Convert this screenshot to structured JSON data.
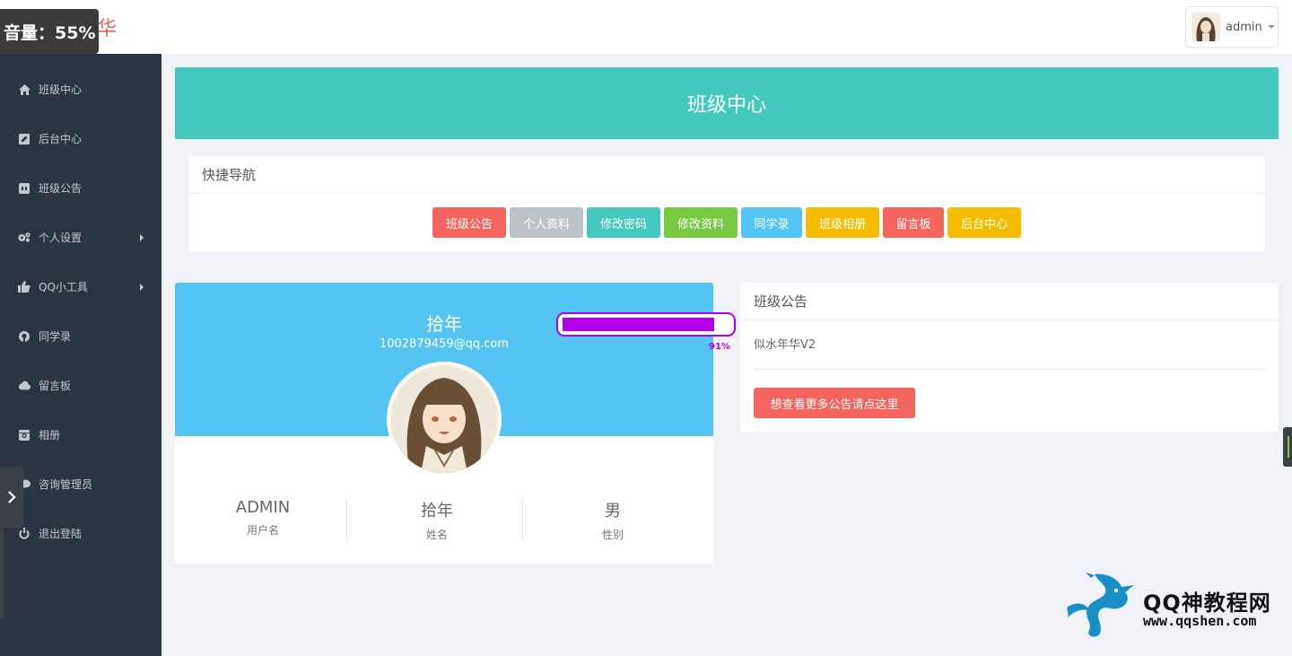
{
  "brand": {
    "title_fragment": "华"
  },
  "volume_overlay": {
    "label": "音量：55%"
  },
  "user_menu": {
    "name": "admin"
  },
  "sidebar": {
    "items": [
      {
        "label": "班级中心",
        "icon": "home-icon",
        "has_submenu": false
      },
      {
        "label": "后台中心",
        "icon": "edit-square-icon",
        "has_submenu": false
      },
      {
        "label": "班级公告",
        "icon": "gamepad-icon",
        "has_submenu": false
      },
      {
        "label": "个人设置",
        "icon": "gears-icon",
        "has_submenu": true
      },
      {
        "label": "QQ小工具",
        "icon": "thumbs-up-icon",
        "has_submenu": true
      },
      {
        "label": "同学录",
        "icon": "github-icon",
        "has_submenu": false
      },
      {
        "label": "留言板",
        "icon": "cloud-icon",
        "has_submenu": false
      },
      {
        "label": "相册",
        "icon": "instagram-icon",
        "has_submenu": false
      },
      {
        "label": "咨询管理员",
        "icon": "chat-icon",
        "has_submenu": false
      },
      {
        "label": "退出登陆",
        "icon": "power-icon",
        "has_submenu": false
      }
    ]
  },
  "banner": {
    "title": "班级中心"
  },
  "quick_nav": {
    "title": "快捷导航",
    "buttons": [
      {
        "label": "班级公告",
        "color": "#f5655e"
      },
      {
        "label": "个人资料",
        "color": "#bdc3c7"
      },
      {
        "label": "修改密码",
        "color": "#43c9bf"
      },
      {
        "label": "修改资料",
        "color": "#7ac943"
      },
      {
        "label": "同学录",
        "color": "#54c5f2"
      },
      {
        "label": "班级相册",
        "color": "#f6bd00"
      },
      {
        "label": "留言板",
        "color": "#f5655e"
      },
      {
        "label": "后台中心",
        "color": "#f6bd00"
      }
    ]
  },
  "profile": {
    "name": "拾年",
    "email": "1002879459@qq.com",
    "stats": [
      {
        "value": "ADMIN",
        "label": "用户名"
      },
      {
        "value": "拾年",
        "label": "姓名"
      },
      {
        "value": "男",
        "label": "性别"
      }
    ]
  },
  "progress_widget": {
    "percent_label": "91%",
    "value": 0.91,
    "color": "#b400e6"
  },
  "notice": {
    "title": "班级公告",
    "content": "似水年华V2",
    "more_button": "想查看更多公告请点这里"
  },
  "watermark": {
    "name": "QQ神教程网",
    "url": "www.qqshen.com"
  },
  "colors": {
    "sidebar_bg": "#2b3542",
    "banner": "#43c9bf",
    "profile_head": "#54c5f2",
    "brand": "#f0655a"
  }
}
